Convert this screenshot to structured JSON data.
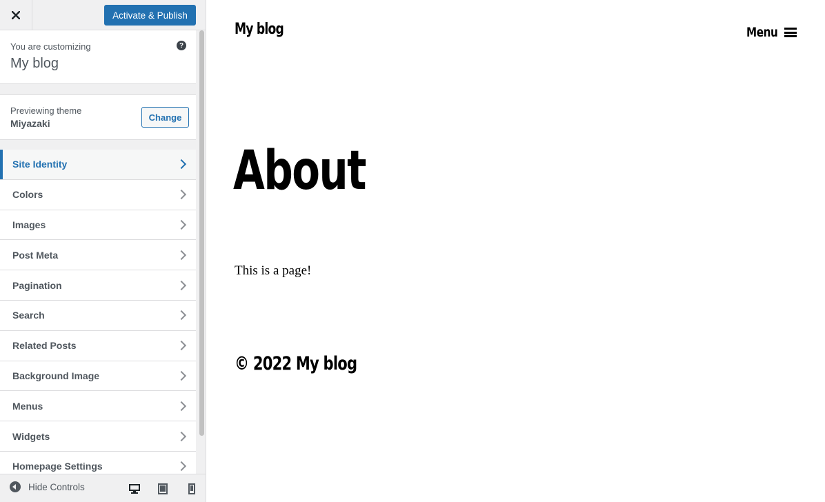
{
  "topbar": {
    "close_icon": "close-icon",
    "publish_label": "Activate & Publish"
  },
  "info": {
    "customizing_label": "You are customizing",
    "site_name": "My blog",
    "help_icon": "help-icon",
    "help_glyph": "?"
  },
  "theme": {
    "label": "Previewing theme",
    "name": "Miyazaki",
    "change_label": "Change"
  },
  "sections": [
    {
      "label": "Site Identity",
      "active": true
    },
    {
      "label": "Colors"
    },
    {
      "label": "Images"
    },
    {
      "label": "Post Meta"
    },
    {
      "label": "Pagination"
    },
    {
      "label": "Search"
    },
    {
      "label": "Related Posts"
    },
    {
      "label": "Background Image"
    },
    {
      "label": "Menus"
    },
    {
      "label": "Widgets"
    },
    {
      "label": "Homepage Settings"
    }
  ],
  "footer": {
    "hide_label": "Hide Controls",
    "devices": [
      "desktop-icon",
      "tablet-icon",
      "mobile-icon"
    ]
  },
  "preview": {
    "site_title": "My blog",
    "menu_label": "Menu",
    "page_title": "About",
    "page_body": "This is a page!",
    "copyright": "© 2022 My blog"
  },
  "colors": {
    "accent": "#2271b1",
    "sidebar_bg": "#f0f0f1",
    "text": "#50575e"
  }
}
